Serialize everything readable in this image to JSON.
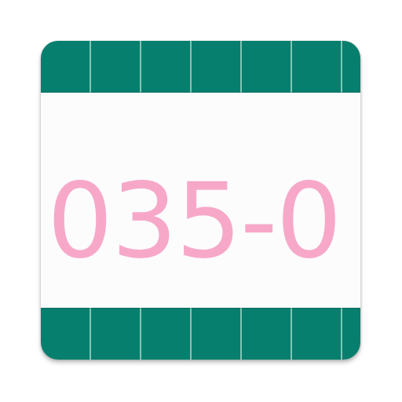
{
  "icon": {
    "code_text": "035-0",
    "colors": {
      "band": "#067f6e",
      "band_grid": "#aadccd",
      "background": "#fcfcfd",
      "text": "#f7a8c8"
    }
  }
}
